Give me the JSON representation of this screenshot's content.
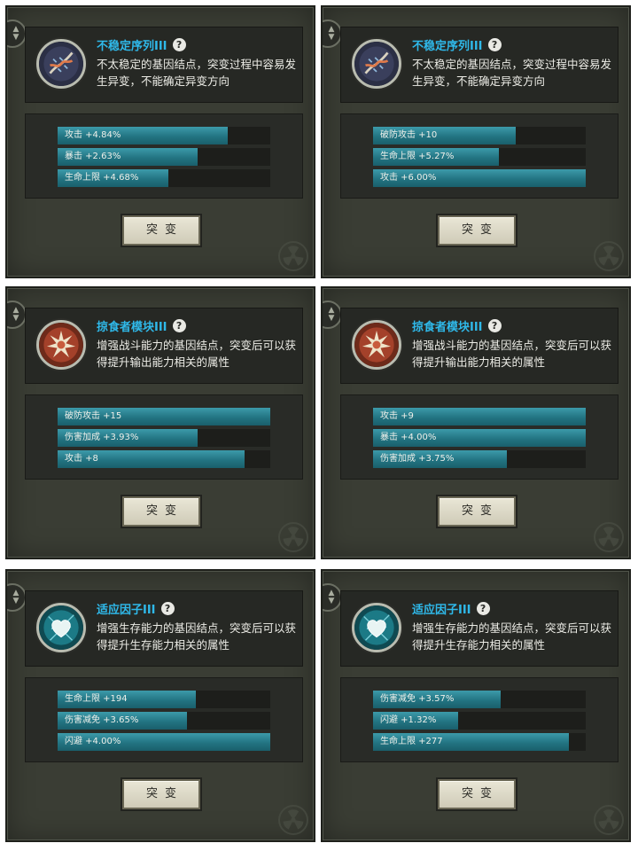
{
  "mutate_label": "突变",
  "colors": {
    "title": "#2fb9ea",
    "bar_fill": "#237482",
    "panel_bg": "#3a3d34"
  },
  "panels": [
    {
      "title": "不稳定序列III",
      "icon": "dna-icon",
      "description": "不太稳定的基因结点，突变过程中容易发生异变，不能确定异变方向",
      "stats": [
        {
          "label": "攻击 +4.84%",
          "fill": 0.8
        },
        {
          "label": "暴击 +2.63%",
          "fill": 0.66
        },
        {
          "label": "生命上限 +4.68%",
          "fill": 0.52
        }
      ]
    },
    {
      "title": "不稳定序列III",
      "icon": "dna-icon",
      "description": "不太稳定的基因结点，突变过程中容易发生异变，不能确定异变方向",
      "stats": [
        {
          "label": "破防攻击 +10",
          "fill": 0.67
        },
        {
          "label": "生命上限 +5.27%",
          "fill": 0.59
        },
        {
          "label": "攻击 +6.00%",
          "fill": 1.0
        }
      ]
    },
    {
      "title": "掠食者模块III",
      "icon": "spiked-burst-icon",
      "description": "增强战斗能力的基因结点，突变后可以获得提升输出能力相关的属性",
      "stats": [
        {
          "label": "破防攻击 +15",
          "fill": 1.0
        },
        {
          "label": "伤害加成 +3.93%",
          "fill": 0.66
        },
        {
          "label": "攻击 +8",
          "fill": 0.88
        }
      ]
    },
    {
      "title": "掠食者模块III",
      "icon": "spiked-burst-icon",
      "description": "增强战斗能力的基因结点，突变后可以获得提升输出能力相关的属性",
      "stats": [
        {
          "label": "攻击 +9",
          "fill": 1.0
        },
        {
          "label": "暴击 +4.00%",
          "fill": 1.0
        },
        {
          "label": "伤害加成 +3.75%",
          "fill": 0.63
        }
      ]
    },
    {
      "title": "适应因子III",
      "icon": "heart-icon",
      "description": "增强生存能力的基因结点，突变后可以获得提升生存能力相关的属性",
      "stats": [
        {
          "label": "生命上限 +194",
          "fill": 0.65
        },
        {
          "label": "伤害减免 +3.65%",
          "fill": 0.61
        },
        {
          "label": "闪避 +4.00%",
          "fill": 1.0
        }
      ]
    },
    {
      "title": "适应因子III",
      "icon": "heart-icon",
      "description": "增强生存能力的基因结点，突变后可以获得提升生存能力相关的属性",
      "stats": [
        {
          "label": "伤害减免 +3.57%",
          "fill": 0.6
        },
        {
          "label": "闪避 +1.32%",
          "fill": 0.4
        },
        {
          "label": "生命上限 +277",
          "fill": 0.92
        }
      ]
    }
  ]
}
